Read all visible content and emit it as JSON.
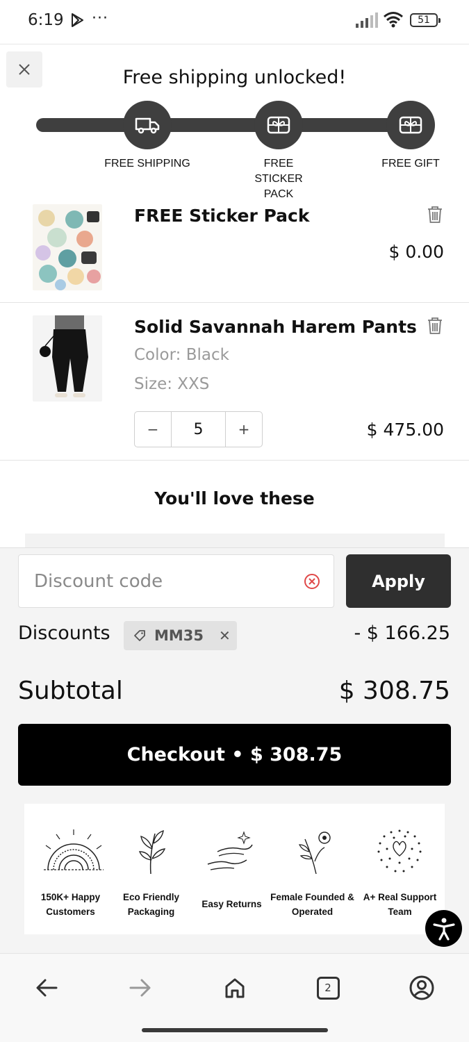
{
  "status_bar": {
    "time": "6:19",
    "battery": "51",
    "icons": [
      "play-store-icon",
      "more-dots-icon",
      "signal-icon",
      "wifi-icon",
      "battery-icon"
    ]
  },
  "shipping": {
    "title": "Free shipping unlocked!",
    "milestones": [
      {
        "label": "FREE SHIPPING",
        "icon": "truck-icon"
      },
      {
        "label": "FREE STICKER PACK",
        "icon": "gift-icon"
      },
      {
        "label": "FREE GIFT",
        "icon": "gift-icon"
      }
    ]
  },
  "cart": {
    "items": [
      {
        "name": "FREE Sticker Pack",
        "price": "$ 0.00"
      },
      {
        "name": "Solid Savannah Harem Pants",
        "color": "Color: Black",
        "size": "Size: XXS",
        "quantity": "5",
        "price": "$ 475.00",
        "qty_minus": "−",
        "qty_plus": "+"
      }
    ]
  },
  "recommendations": {
    "title": "You'll love these"
  },
  "discount": {
    "placeholder": "Discount code",
    "apply_label": "Apply",
    "label": "Discounts",
    "code": "MM35",
    "amount": "- $ 166.25"
  },
  "summary": {
    "subtotal_label": "Subtotal",
    "subtotal_amount": "$ 308.75",
    "checkout_label": "Checkout • $ 308.75"
  },
  "badges": [
    {
      "label": "150K+ Happy Customers",
      "icon": "rainbow-icon"
    },
    {
      "label": "Eco Friendly Packaging",
      "icon": "leaf-icon"
    },
    {
      "label": "Easy Returns",
      "icon": "hands-icon"
    },
    {
      "label": "Female Founded & Operated",
      "icon": "flower-icon"
    },
    {
      "label": "A+ Real Support Team",
      "icon": "heart-dots-icon"
    }
  ],
  "browser_nav": {
    "tabs_count": "2"
  },
  "colors": {
    "progress": "#3f3f3f",
    "checkout": "#000000",
    "apply": "#2f2f2f",
    "clear_icon": "#e04848"
  }
}
